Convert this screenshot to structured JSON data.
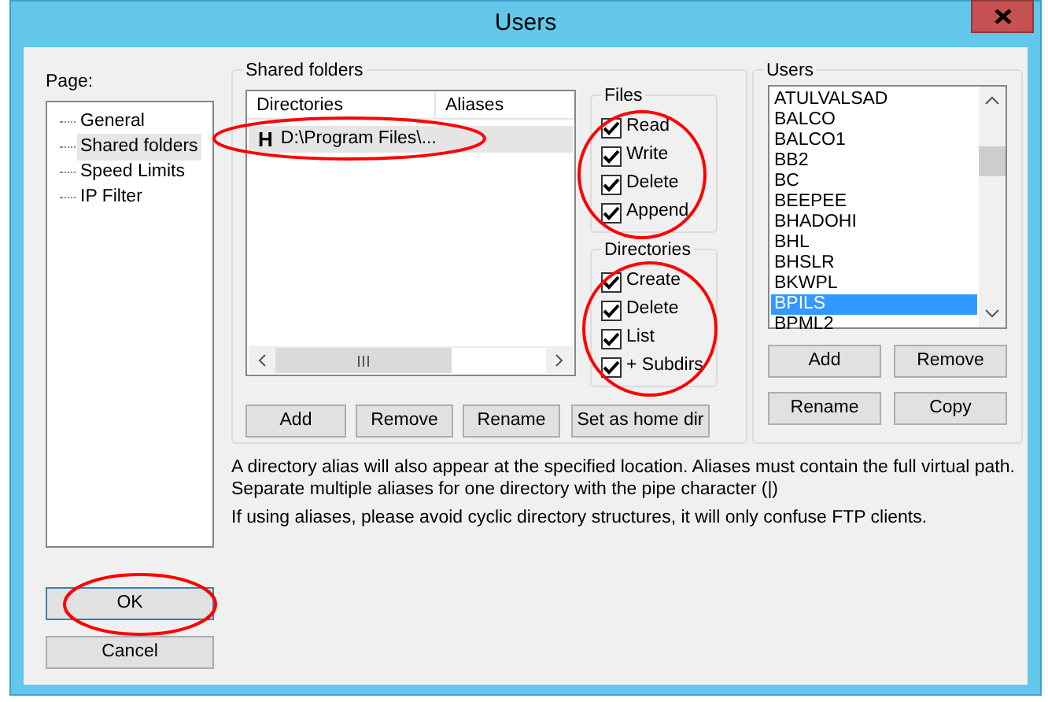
{
  "window": {
    "title": "Users"
  },
  "page": {
    "label": "Page:",
    "items": [
      {
        "label": "General",
        "selected": false
      },
      {
        "label": "Shared folders",
        "selected": true
      },
      {
        "label": "Speed Limits",
        "selected": false
      },
      {
        "label": "IP Filter",
        "selected": false
      }
    ]
  },
  "shared_folders": {
    "title": "Shared folders",
    "columns": [
      "Directories",
      "Aliases"
    ],
    "rows": [
      {
        "marker": "H",
        "directory": "D:\\Program Files\\...",
        "selected": true
      }
    ],
    "buttons": [
      "Add",
      "Remove",
      "Rename",
      "Set as home dir"
    ]
  },
  "files": {
    "title": "Files",
    "options": [
      {
        "label": "Read",
        "checked": true
      },
      {
        "label": "Write",
        "checked": true
      },
      {
        "label": "Delete",
        "checked": true
      },
      {
        "label": "Append",
        "checked": true
      }
    ]
  },
  "directories": {
    "title": "Directories",
    "options": [
      {
        "label": "Create",
        "checked": true
      },
      {
        "label": "Delete",
        "checked": true
      },
      {
        "label": "List",
        "checked": true
      },
      {
        "label": "+ Subdirs",
        "checked": true
      }
    ]
  },
  "users": {
    "title": "Users",
    "items": [
      {
        "label": "ATULVALSAD",
        "selected": false
      },
      {
        "label": "BALCO",
        "selected": false
      },
      {
        "label": "BALCO1",
        "selected": false
      },
      {
        "label": "BB2",
        "selected": false
      },
      {
        "label": "BC",
        "selected": false
      },
      {
        "label": "BEEPEE",
        "selected": false
      },
      {
        "label": "BHADOHI",
        "selected": false
      },
      {
        "label": "BHL",
        "selected": false
      },
      {
        "label": "BHSLR",
        "selected": false
      },
      {
        "label": "BKWPL",
        "selected": false
      },
      {
        "label": "BPILS",
        "selected": true
      },
      {
        "label": "BPML2",
        "selected": false
      }
    ],
    "buttons": [
      "Add",
      "Remove",
      "Rename",
      "Copy"
    ]
  },
  "notes": [
    "A directory alias will also appear at the specified location. Aliases must contain the full virtual path. Separate multiple aliases for one directory with the pipe character (|)",
    "If using aliases, please avoid cyclic directory structures, it will only confuse FTP clients."
  ],
  "dialog_buttons": [
    {
      "label": "OK",
      "default": true
    },
    {
      "label": "Cancel",
      "default": false
    }
  ]
}
